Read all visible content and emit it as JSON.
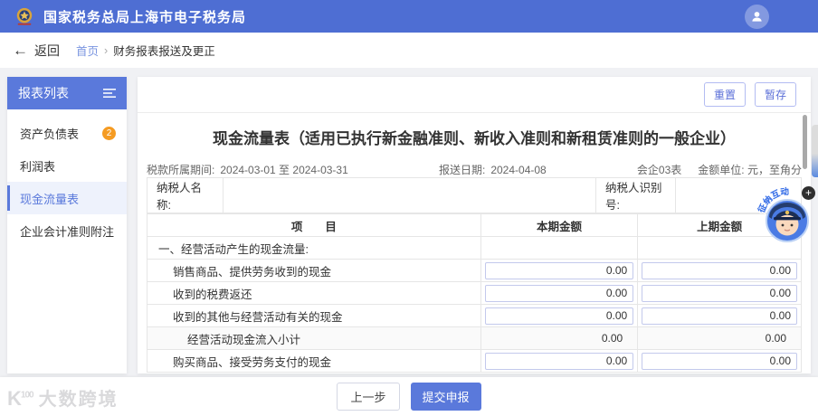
{
  "app": {
    "title": "国家税务总局上海市电子税务局"
  },
  "nav": {
    "back_label": "返回",
    "breadcrumb_home": "首页",
    "breadcrumb_current": "财务报表报送及更正"
  },
  "sidebar": {
    "title": "报表列表",
    "items": [
      {
        "label": "资产负债表",
        "badge": "2",
        "active": false
      },
      {
        "label": "利润表",
        "badge": "",
        "active": false
      },
      {
        "label": "现金流量表",
        "badge": "",
        "active": true
      },
      {
        "label": "企业会计准则附注",
        "badge": "",
        "active": false
      }
    ]
  },
  "toolbar": {
    "reset_label": "重置",
    "draft_label": "暂存"
  },
  "form": {
    "title": "现金流量表（适用已执行新金融准则、新收入准则和新租赁准则的一般企业）",
    "period_label": "税款所属期间:",
    "period_value": "2024-03-01  至  2024-03-31",
    "submit_date_label": "报送日期:",
    "submit_date_value": "2024-04-08",
    "form_code": "会企03表",
    "unit_label": "金额单位:",
    "unit_value": "元，至角分",
    "taxpayer_name_label": "纳税人名称:",
    "taxpayer_name_value": "",
    "taxpayer_id_label": "纳税人识别号:",
    "taxpayer_id_value": ""
  },
  "table": {
    "headers": [
      "项　　目",
      "本期金额",
      "上期金额"
    ],
    "rows": [
      {
        "label": "一、经营活动产生的现金流量:",
        "indent": 0,
        "type": "section",
        "current": "",
        "prior": ""
      },
      {
        "label": "销售商品、提供劳务收到的现金",
        "indent": 1,
        "type": "input",
        "current": "0.00",
        "prior": "0.00"
      },
      {
        "label": "收到的税费返还",
        "indent": 1,
        "type": "input",
        "current": "0.00",
        "prior": "0.00"
      },
      {
        "label": "收到的其他与经营活动有关的现金",
        "indent": 1,
        "type": "input",
        "current": "0.00",
        "prior": "0.00"
      },
      {
        "label": "经营活动现金流入小计",
        "indent": 2,
        "type": "subtotal",
        "current": "0.00",
        "prior": "0.00"
      },
      {
        "label": "购买商品、接受劳务支付的现金",
        "indent": 1,
        "type": "input",
        "current": "0.00",
        "prior": "0.00"
      }
    ]
  },
  "footer": {
    "prev_label": "上一步",
    "submit_label": "提交申报"
  },
  "floating": {
    "assistant_label": "征纳互动",
    "plus_label": "+"
  },
  "watermark": {
    "logo_k": "K",
    "logo_num": "100",
    "text": "大数跨境"
  },
  "colors": {
    "topbar": "#4e6ed3",
    "primary": "#5a79db",
    "badge": "#f59b22",
    "link": "#7a95e0"
  }
}
